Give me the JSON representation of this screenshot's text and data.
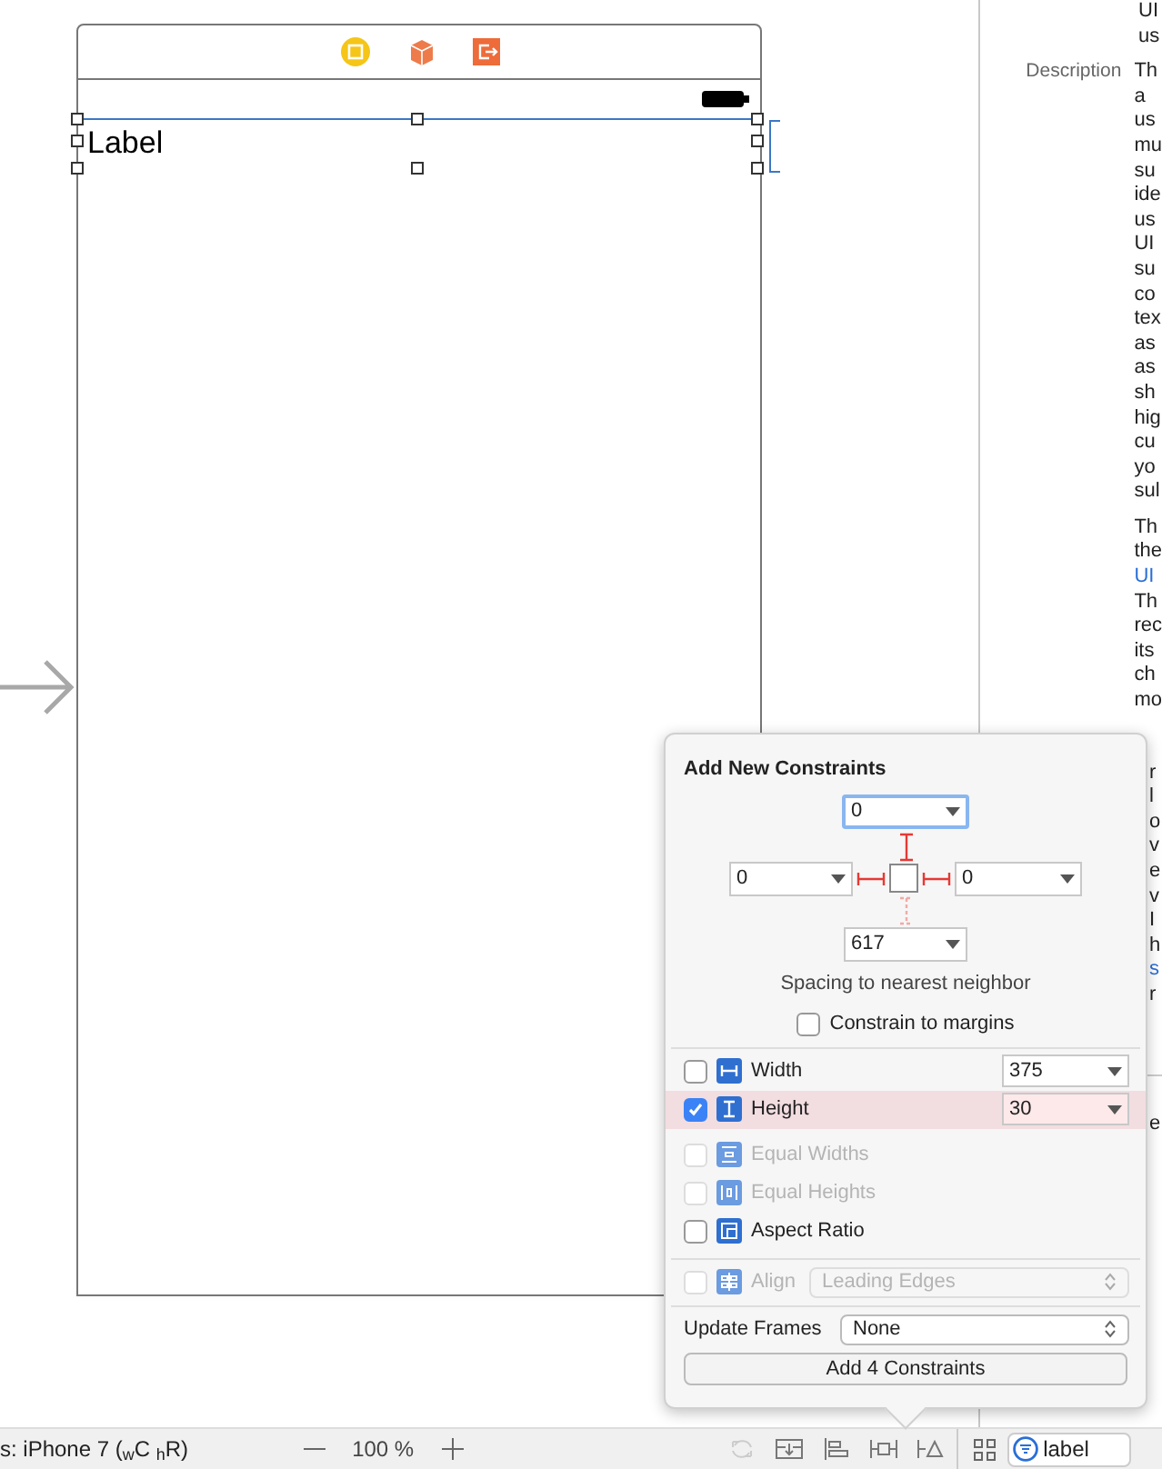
{
  "scene": {
    "label": "Label",
    "selected": true
  },
  "inspector": {
    "top_lines": [
      "UI",
      "us"
    ],
    "rows": [
      {
        "label": "Description",
        "paragraphs": [
          {
            "lines": [
              {
                "text": "Th"
              },
              {
                "text": "a"
              },
              {
                "text": "us"
              },
              {
                "text": "mu"
              },
              {
                "text": "su"
              },
              {
                "text": "ide"
              },
              {
                "text": "us"
              },
              {
                "text": "UI"
              },
              {
                "text": "su"
              },
              {
                "text": "co"
              },
              {
                "text": "tex"
              },
              {
                "text": "as"
              },
              {
                "text": "as"
              },
              {
                "text": "sh"
              },
              {
                "text": "hig"
              },
              {
                "text": "cu"
              },
              {
                "text": "yo"
              },
              {
                "text": "sul"
              }
            ]
          },
          {
            "lines": [
              {
                "text": "Th"
              },
              {
                "text": "the"
              },
              {
                "text": "UI",
                "kind": "link"
              },
              {
                "text": "Th"
              },
              {
                "text": "rec"
              },
              {
                "text": "its"
              },
              {
                "text": "ch"
              },
              {
                "text": "mo"
              }
            ]
          }
        ]
      }
    ],
    "beside_popover": [
      {
        "text": "r"
      },
      {
        "text": "l"
      },
      {
        "text": "o"
      },
      {
        "text": "v"
      },
      {
        "text": "e"
      },
      {
        "text": "v"
      },
      {
        "text": "I"
      },
      {
        "text": "h"
      },
      {
        "text": "s",
        "kind": "link"
      },
      {
        "text": "r"
      }
    ],
    "below_lines": [
      "e"
    ]
  },
  "popover": {
    "title": "Add New Constraints",
    "spacing": {
      "top": {
        "value": "0",
        "focused": true,
        "active": true
      },
      "left": {
        "value": "0",
        "focused": false,
        "active": true
      },
      "right": {
        "value": "0",
        "focused": false,
        "active": true
      },
      "bottom": {
        "value": "617",
        "focused": false,
        "active": false
      }
    },
    "caption": "Spacing to nearest neighbor",
    "constrain_to_margins": {
      "label": "Constrain to margins",
      "checked": false
    },
    "size_rows": [
      {
        "kind": "width",
        "label": "Width",
        "checked": false,
        "value": "375"
      },
      {
        "kind": "height",
        "label": "Height",
        "checked": true,
        "value": "30"
      }
    ],
    "relation_rows": [
      {
        "kind": "equal-widths",
        "label": "Equal Widths",
        "checked": false,
        "disabled": true
      },
      {
        "kind": "equal-heights",
        "label": "Equal Heights",
        "checked": false,
        "disabled": true
      },
      {
        "kind": "aspect",
        "label": "Aspect Ratio",
        "checked": false,
        "disabled": false
      }
    ],
    "align": {
      "label": "Align",
      "checked": false,
      "disabled": true,
      "value": "Leading Edges"
    },
    "update_frames": {
      "label": "Update Frames",
      "value": "None"
    },
    "button": "Add 4 Constraints"
  },
  "bottom_bar": {
    "device": "s: iPhone 7 ($_{w}$C $_{h}$R)",
    "zoom": "100 %",
    "search": "label"
  }
}
